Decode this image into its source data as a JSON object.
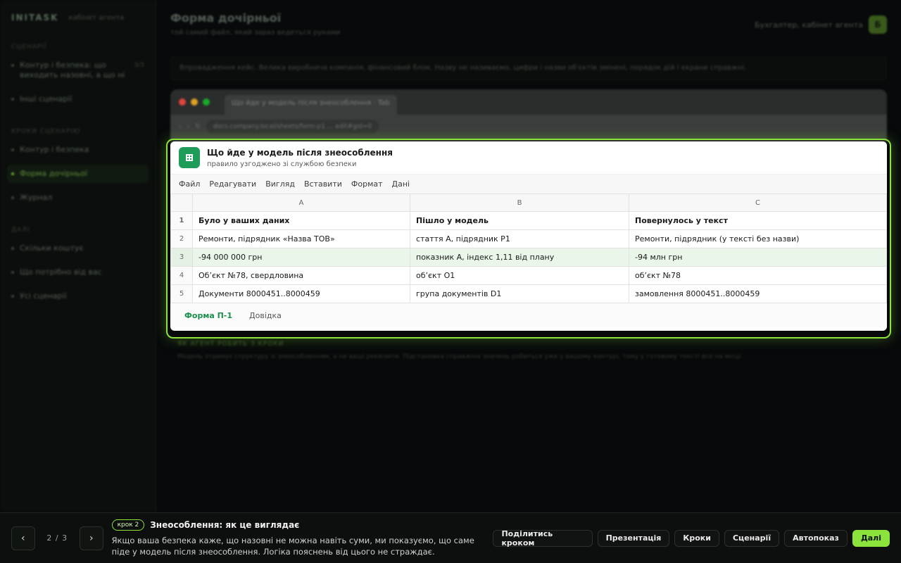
{
  "app": {
    "logo": "INITASK",
    "subtitle": "кабінет агента",
    "user_label": "Бухгалтер, кабінет агента",
    "user_initial": "Б"
  },
  "sidebar": {
    "section1": "СЦЕНАРІЇ",
    "items1": [
      {
        "label": "Контур і безпека: що виходить назовні, а що ні",
        "count": "3/3"
      },
      {
        "label": "Інші сценарії",
        "count": ""
      }
    ],
    "section2": "КРОКИ СЦЕНАРІЮ",
    "items2": [
      {
        "label": "Контур і безпека"
      },
      {
        "label": "Форма дочірньої"
      },
      {
        "label": "Журнал"
      }
    ],
    "section3": "ДАЛІ",
    "items3": [
      {
        "label": "Скільки коштує"
      },
      {
        "label": "Що потрібно від вас"
      },
      {
        "label": "Усі сценарії"
      }
    ]
  },
  "main": {
    "title": "Форма дочірньої",
    "subtitle": "той самий файл, який зараз ведеться руками",
    "notice": "Впровадження кейс. Велика виробнича компанія, фінансовий блок. Назву не називаємо, цифри і назви об'єктів змінені, порядок дій і екрани справжні."
  },
  "browser": {
    "tab": "Що йде у модель після знеособлення · Tab",
    "url": "docs.company.local/sheets/form-p1 ... edit#gid=0"
  },
  "sheet": {
    "title": "Що йде у модель після знеособлення",
    "subtitle": "правило узгоджено зі службою безпеки",
    "menu": [
      "Файл",
      "Редагувати",
      "Вигляд",
      "Вставити",
      "Формат",
      "Дані"
    ],
    "columns": [
      "A",
      "B",
      "C"
    ],
    "rows": [
      {
        "n": "1",
        "a": "Було у ваших даних",
        "b": "Пішло у модель",
        "c": "Повернулось у текст"
      },
      {
        "n": "2",
        "a": "Ремонти, підрядник «Назва ТОВ»",
        "b": "стаття A, підрядник P1",
        "c": "Ремонти, підрядник (у тексті без назви)"
      },
      {
        "n": "3",
        "a": "-94 000 000 грн",
        "b": "показник A, індекс 1,11 від плану",
        "c": "-94 млн грн"
      },
      {
        "n": "4",
        "a": "Об’єкт №78, свердловина",
        "b": "об’єкт O1",
        "c": "об’єкт №78"
      },
      {
        "n": "5",
        "a": "Документи 8000451..8000459",
        "b": "група документів D1",
        "c": "замовлення 8000451..8000459"
      }
    ],
    "tabs": [
      "Форма П-1",
      "Довідка"
    ]
  },
  "below": {
    "label": "ЯК АГЕНТ РОБИТЬ 3 КРОКИ",
    "text": "Модель отримує структуру зі знеособленням, а не ваші реквізити. Підстановка справжніх значень робиться уже у вашому контурі, тому у готовому тексті все на місці."
  },
  "tour": {
    "pager": "2 / 3",
    "badge": "крок 2",
    "title": "Знеособлення: як це виглядає",
    "desc": "Якщо ваша безпека каже, що назовні не можна навіть суми, ми показуємо, що саме піде у модель після знеособлення. Логіка пояснень від цього не страждає.",
    "actions": [
      "Поділитись кроком",
      "Презентація",
      "Кроки",
      "Сценарії",
      "Автопоказ"
    ],
    "primary": "Далі"
  }
}
